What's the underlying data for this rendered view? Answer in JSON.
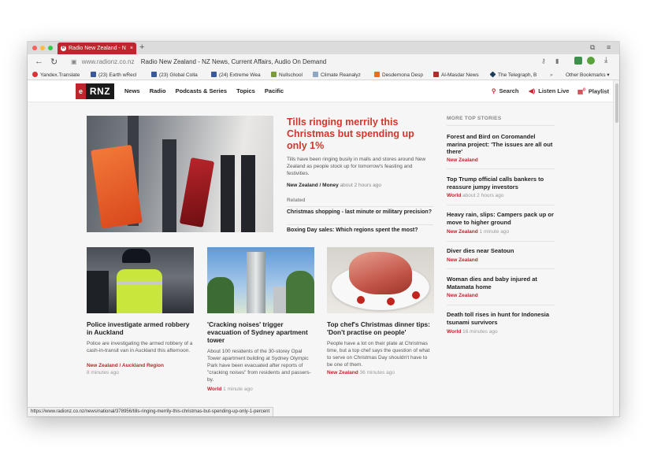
{
  "browser": {
    "tab_title": "Radio New Zealand - N",
    "url_host": "www.radionz.co.nz",
    "url_title": "Radio New Zealand - NZ News, Current Affairs, Audio On Demand",
    "bookmarks": [
      "Yandex.Translate",
      "(23) Earth wRecl",
      "(23) Global Colla",
      "(24) Extreme Wea",
      "Nullschool",
      "Climate Reanalyz",
      "Desdemona Desp",
      "Al-Masdar News",
      "The Telegraph, B"
    ],
    "other_bookmarks": "Other Bookmarks",
    "status_url": "https://www.radionz.co.nz/news/national/378956/tills-ringing-merrily-this-christmas-but-spending-up-only-1-percent"
  },
  "site": {
    "logo_text": "RNZ",
    "nav": [
      "News",
      "Radio",
      "Podcasts & Series",
      "Topics",
      "Pacific"
    ],
    "search_label": "Search",
    "listen_label": "Listen Live",
    "playlist_label": "Playlist",
    "playlist_count": "0"
  },
  "hero": {
    "title": "Tills ringing merrily this Christmas but spending up only 1%",
    "summary": "Tills have been ringing busily in malls and stores around New Zealand as people stock up for tomorrow's feasting and festivities.",
    "category": "New Zealand / Money",
    "time": "about 2 hours ago",
    "related_label": "Related",
    "related": [
      "Christmas shopping - last minute or military precision?",
      "Boxing Day sales: Which regions spent the most?"
    ]
  },
  "cards": [
    {
      "title": "Police investigate armed robbery in Auckland",
      "summary": "Police are investigating the armed robbery of a cash-in-transit van in Auckland this afternoon.",
      "category": "New Zealand / Auckland Region",
      "time": "8 minutes ago"
    },
    {
      "title": "'Cracking noises' trigger evacuation of Sydney apartment tower",
      "summary": "About 100 residents of the 30-storey Opal Tower apartment building at Sydney Olympic Park have been evacuated after reports of \"cracking noises\" from residents and passers-by.",
      "category": "World",
      "time": "1 minute ago"
    },
    {
      "title": "Top chef's Christmas dinner tips: 'Don't practise on people'",
      "summary": "People have a lot on their plate at Christmas time, but a top chef says the question of what to serve on Christmas Day shouldn't have to be one of them.",
      "category": "New Zealand",
      "time": "36 minutes ago"
    }
  ],
  "sidebar": {
    "heading": "MORE TOP STORIES",
    "stories": [
      {
        "title": "Forest and Bird on Coromandel marina project: 'The issues are all out there'",
        "category": "New Zealand",
        "time": ""
      },
      {
        "title": "Top Trump official calls bankers to reassure jumpy investors",
        "category": "World",
        "time": "about 2 hours ago"
      },
      {
        "title": "Heavy rain, slips: Campers pack up or move to higher ground",
        "category": "New Zealand",
        "time": "1 minute ago"
      },
      {
        "title": "Diver dies near Seatoun",
        "category": "New Zealand",
        "time": ""
      },
      {
        "title": "Woman dies and baby injured at Matamata home",
        "category": "New Zealand",
        "time": ""
      },
      {
        "title": "Death toll rises in hunt for Indonesia tsunami survivors",
        "category": "World",
        "time": "16 minutes ago"
      }
    ]
  },
  "colors": {
    "accent": "#c0242c",
    "headline": "#d3362c"
  }
}
